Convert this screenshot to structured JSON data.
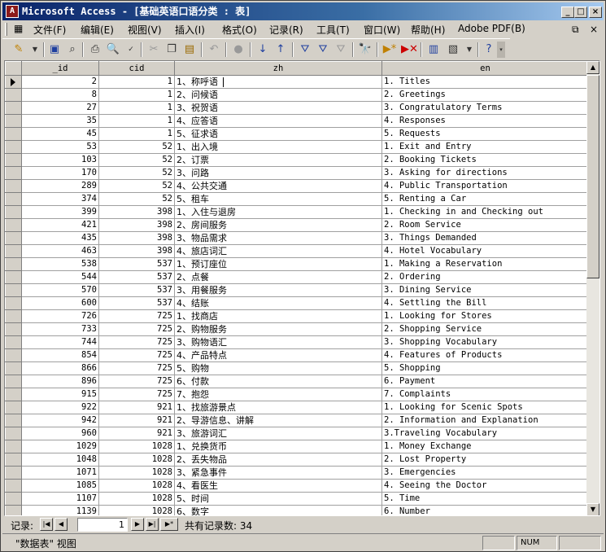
{
  "window": {
    "title": "Microsoft Access - [基础英语口语分类 : 表]",
    "app_icon": "access-key-icon",
    "controls": {
      "minimize": "_",
      "maximize": "□",
      "close": "×"
    }
  },
  "menu": {
    "items": [
      {
        "label": "文件(F)"
      },
      {
        "label": "编辑(E)"
      },
      {
        "label": "视图(V)"
      },
      {
        "label": "插入(I)"
      },
      {
        "label": "格式(O)"
      },
      {
        "label": "记录(R)"
      },
      {
        "label": "工具(T)"
      },
      {
        "label": "窗口(W)"
      },
      {
        "label": "帮助(H)"
      },
      {
        "label": "Adobe PDF(B)"
      }
    ],
    "mdi": {
      "restore": "⧉",
      "close": "×"
    }
  },
  "toolbar": {
    "icons": [
      "view-icon",
      "save-icon",
      "search-file-icon",
      "print-icon",
      "print-preview-icon",
      "spelling-icon",
      "cut-icon",
      "copy-icon",
      "paste-icon",
      "undo-icon",
      "hyperlink-icon",
      "sort-ascending-icon",
      "sort-descending-icon",
      "filter-by-selection-icon",
      "filter-by-form-icon",
      "apply-filter-icon",
      "find-icon",
      "new-record-icon",
      "delete-record-icon",
      "database-window-icon",
      "new-object-icon",
      "help-icon"
    ]
  },
  "table": {
    "columns": [
      "_id",
      "cid",
      "zh",
      "en"
    ],
    "rows": [
      [
        "2",
        "1",
        "1、称呼语",
        "1. Titles"
      ],
      [
        "8",
        "1",
        "2、问候语",
        "2. Greetings"
      ],
      [
        "27",
        "1",
        "3、祝贺语",
        "3. Congratulatory Terms"
      ],
      [
        "35",
        "1",
        "4、应答语",
        "4. Responses"
      ],
      [
        "45",
        "1",
        "5、征求语",
        "5. Requests"
      ],
      [
        "53",
        "52",
        "1、出入境",
        "1. Exit and Entry"
      ],
      [
        "103",
        "52",
        "2、订票",
        "2. Booking Tickets"
      ],
      [
        "170",
        "52",
        "3、问路",
        "3. Asking for directions"
      ],
      [
        "289",
        "52",
        "4、公共交通",
        "4. Public Transportation"
      ],
      [
        "374",
        "52",
        "5、租车",
        "5. Renting a Car"
      ],
      [
        "399",
        "398",
        "1、入住与退房",
        "1. Checking in and Checking out"
      ],
      [
        "421",
        "398",
        "2、房间服务",
        "2. Room Service"
      ],
      [
        "435",
        "398",
        "3、物品需求",
        "3. Things Demanded"
      ],
      [
        "463",
        "398",
        "4、旅店词汇",
        "4. Hotel Vocabulary"
      ],
      [
        "538",
        "537",
        "1、预订座位",
        "1. Making a Reservation"
      ],
      [
        "544",
        "537",
        "2、点餐",
        "2. Ordering"
      ],
      [
        "570",
        "537",
        "3、用餐服务",
        "3. Dining Service"
      ],
      [
        "600",
        "537",
        "4、结账",
        "4. Settling the Bill"
      ],
      [
        "726",
        "725",
        "1、找商店",
        "1. Looking for Stores"
      ],
      [
        "733",
        "725",
        "2、购物服务",
        "2. Shopping Service"
      ],
      [
        "744",
        "725",
        "3、购物语汇",
        "3. Shopping Vocabulary"
      ],
      [
        "854",
        "725",
        "4、产品特点",
        "4. Features of Products"
      ],
      [
        "866",
        "725",
        "5、购物",
        "5. Shopping"
      ],
      [
        "896",
        "725",
        "6、付款",
        "6. Payment"
      ],
      [
        "915",
        "725",
        "7、抱怨",
        "7. Complaints"
      ],
      [
        "922",
        "921",
        "1、找旅游景点",
        "1. Looking for Scenic Spots"
      ],
      [
        "942",
        "921",
        "2、导游信息、讲解",
        "2. Information and Explanation"
      ],
      [
        "960",
        "921",
        "3、旅游词汇",
        "3.Traveling Vocabulary"
      ],
      [
        "1029",
        "1028",
        "1、兑换货币",
        "1. Money Exchange"
      ],
      [
        "1048",
        "1028",
        "2、丢失物品",
        "2. Lost Property"
      ],
      [
        "1071",
        "1028",
        "3、紧急事件",
        "3. Emergencies"
      ],
      [
        "1085",
        "1028",
        "4、看医生",
        "4. Seeing the Doctor"
      ],
      [
        "1107",
        "1028",
        "5、时间",
        "5. Time"
      ],
      [
        "1139",
        "1028",
        "6、数字",
        "6. Number"
      ]
    ]
  },
  "nav": {
    "label": "记录:",
    "current": "1",
    "first": "|◀",
    "prev": "◀",
    "next": "▶",
    "last": "▶|",
    "new": "▶*",
    "total": "共有记录数: 34"
  },
  "status": {
    "text": "\"数据表\" 视图",
    "num": "NUM"
  }
}
